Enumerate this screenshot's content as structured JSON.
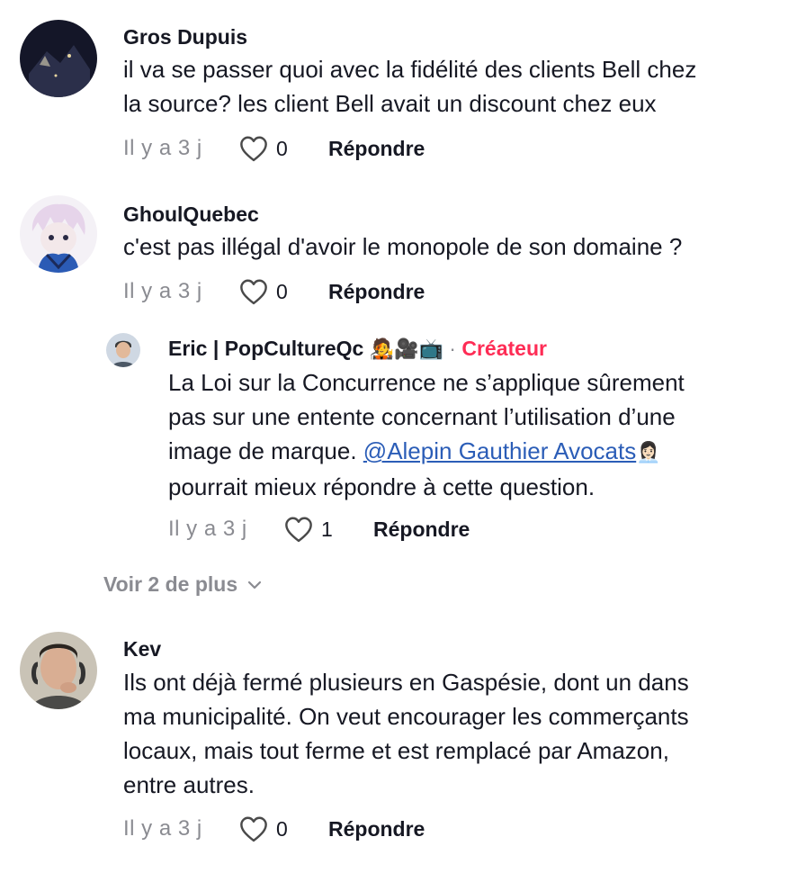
{
  "comments": [
    {
      "author": "Gros Dupuis",
      "lines": [
        "il va se passer quoi avec la fidélité des clients Bell chez",
        "la source? les client Bell avait un discount chez eux"
      ],
      "time": "Il y a 3 j",
      "likes": "0",
      "reply_label": "Répondre"
    },
    {
      "author": "GhoulQuebec",
      "lines": [
        "c'est pas illégal d'avoir le monopole de son domaine ?"
      ],
      "time": "Il y a 3 j",
      "likes": "0",
      "reply_label": "Répondre",
      "replies": [
        {
          "author": "Eric | PopCultureQc",
          "author_emojis": "🧑‍🎤🎥📺",
          "separator": "·",
          "badge": "Créateur",
          "line1": "La Loi sur la Concurrence ne s’applique sûrement",
          "line2": "pas sur une entente concernant l’utilisation d’une",
          "line3_before": "image de marque. ",
          "mention": "@Alepin Gauthier Avocats",
          "mention_emoji": "👩🏻‍💼",
          "line4": "pourrait mieux répondre à cette question.",
          "time": "Il y a 3 j",
          "likes": "1",
          "reply_label": "Répondre"
        }
      ],
      "view_more": "Voir 2 de plus"
    },
    {
      "author": "Kev",
      "lines": [
        "Ils ont déjà fermé plusieurs en Gaspésie, dont un dans",
        "ma municipalité. On veut encourager les commerçants",
        "locaux, mais tout ferme et est remplacé par Amazon,",
        "entre autres."
      ],
      "time": "Il y a 3 j",
      "likes": "0",
      "reply_label": "Répondre"
    }
  ],
  "icons": {
    "like": "heart-outline-icon",
    "expand": "chevron-down-icon"
  }
}
